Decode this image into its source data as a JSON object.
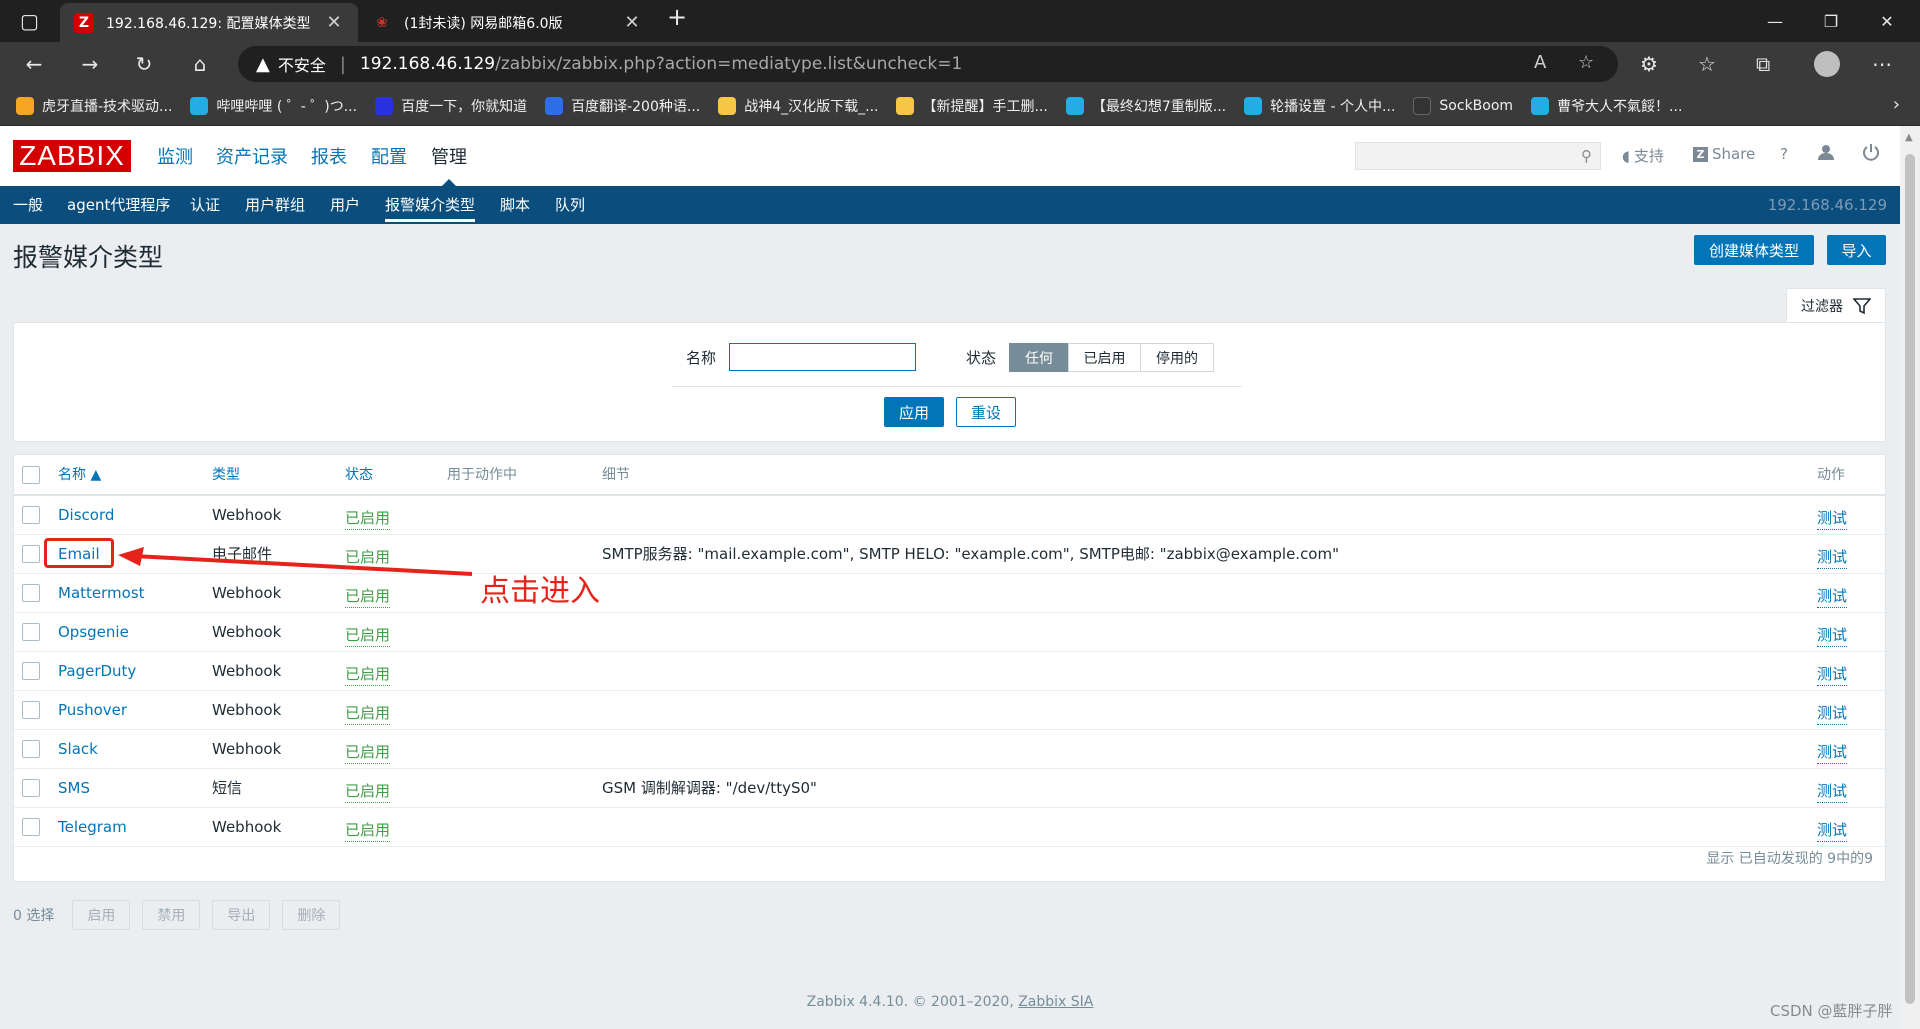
{
  "browser": {
    "tabs": [
      {
        "title": "192.168.46.129: 配置媒体类型",
        "favicon": "Z"
      },
      {
        "title": "(1封未读) 网易邮箱6.0版",
        "favicon": "m"
      }
    ],
    "address": {
      "insecure_label": "不安全",
      "host": "192.168.46.129",
      "path": "/zabbix/zabbix.php?action=mediatype.list&uncheck=1"
    },
    "bookmarks": [
      {
        "label": "虎牙直播-技术驱动...",
        "color": "#f5a623"
      },
      {
        "label": "哔哩哔哩 ( ゜- ゜)つ...",
        "color": "#23ade5"
      },
      {
        "label": "百度一下，你就知道",
        "color": "#2932e1"
      },
      {
        "label": "百度翻译-200种语...",
        "color": "#2e6de8"
      },
      {
        "label": "战神4_汉化版下载_...",
        "color": "#f6c644"
      },
      {
        "label": "【新提醒】手工删...",
        "color": "#f6c644"
      },
      {
        "label": "【最终幻想7重制版...",
        "color": "#23ade5"
      },
      {
        "label": "轮播设置 - 个人中...",
        "color": "#23ade5"
      },
      {
        "label": "SockBoom",
        "color": "#333333"
      },
      {
        "label": "曹爷大人不氣餒！...",
        "color": "#23ade5"
      }
    ]
  },
  "zabbix": {
    "logo": "ZABBIX",
    "main_menu": [
      "监测",
      "资产记录",
      "报表",
      "配置",
      "管理"
    ],
    "top_links": {
      "support": "支持",
      "share": "Share",
      "help": "?"
    },
    "sub_menu": [
      "一般",
      "agent代理程序",
      "认证",
      "用户群组",
      "用户",
      "报警媒介类型",
      "脚本",
      "队列"
    ],
    "server_name": "192.168.46.129",
    "page_title": "报警媒介类型",
    "buttons": {
      "create": "创建媒体类型",
      "import": "导入"
    },
    "filter": {
      "tab_label": "过滤器",
      "name_label": "名称",
      "name_value": "",
      "status_label": "状态",
      "status_options": [
        "任何",
        "已启用",
        "停用的"
      ],
      "status_selected": "任何",
      "apply": "应用",
      "reset": "重设"
    },
    "table": {
      "headers": {
        "name": "名称 ▲",
        "type": "类型",
        "status": "状态",
        "used_in": "用于动作中",
        "details": "细节",
        "action": "动作"
      },
      "rows": [
        {
          "name": "Discord",
          "type": "Webhook",
          "status": "已启用",
          "details": "",
          "action": "测试"
        },
        {
          "name": "Email",
          "type": "电子邮件",
          "status": "已启用",
          "details": "SMTP服务器: \"mail.example.com\", SMTP HELO: \"example.com\", SMTP电邮: \"zabbix@example.com\"",
          "action": "测试"
        },
        {
          "name": "Mattermost",
          "type": "Webhook",
          "status": "已启用",
          "details": "",
          "action": "测试"
        },
        {
          "name": "Opsgenie",
          "type": "Webhook",
          "status": "已启用",
          "details": "",
          "action": "测试"
        },
        {
          "name": "PagerDuty",
          "type": "Webhook",
          "status": "已启用",
          "details": "",
          "action": "测试"
        },
        {
          "name": "Pushover",
          "type": "Webhook",
          "status": "已启用",
          "details": "",
          "action": "测试"
        },
        {
          "name": "Slack",
          "type": "Webhook",
          "status": "已启用",
          "details": "",
          "action": "测试"
        },
        {
          "name": "SMS",
          "type": "短信",
          "status": "已启用",
          "details": "GSM 调制解调器: \"/dev/ttyS0\"",
          "action": "测试"
        },
        {
          "name": "Telegram",
          "type": "Webhook",
          "status": "已启用",
          "details": "",
          "action": "测试"
        }
      ],
      "footer": "显示 已自动发现的 9中的9"
    },
    "bottom": {
      "selected": "0 选择",
      "buttons": [
        "启用",
        "禁用",
        "导出",
        "删除"
      ]
    },
    "footer": {
      "text": "Zabbix 4.4.10. © 2001–2020,",
      "link": "Zabbix SIA"
    }
  },
  "annotation": {
    "text": "点击进入",
    "color": "#e5231a"
  },
  "watermark": "CSDN @藍胖子胖"
}
